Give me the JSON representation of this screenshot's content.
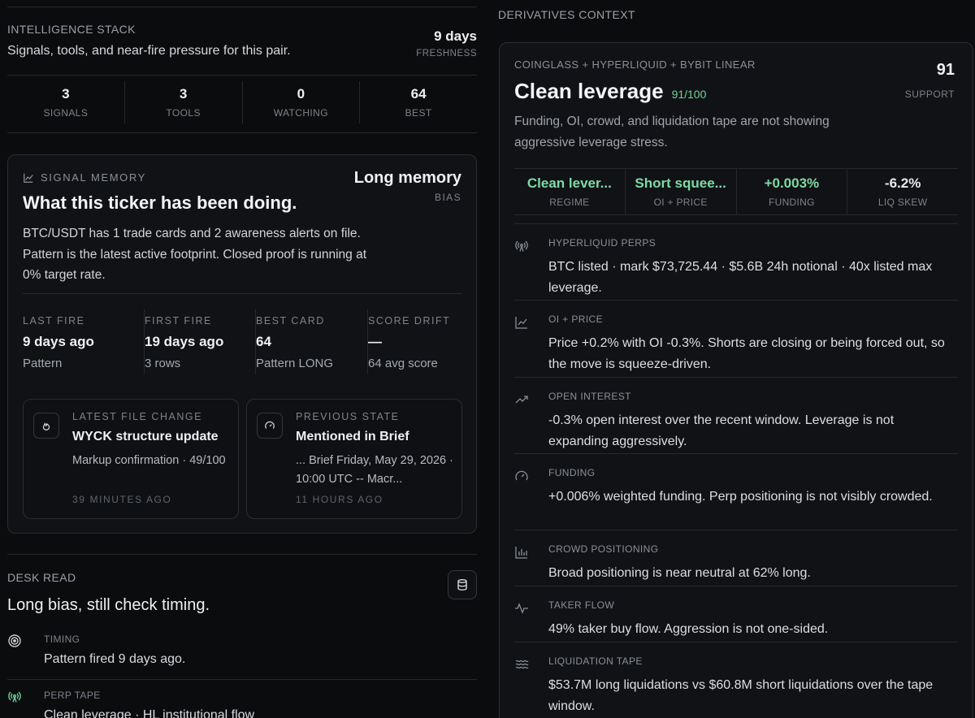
{
  "intel": {
    "title": "INTELLIGENCE STACK",
    "subtitle": "Signals, tools, and near-fire pressure for this pair.",
    "freshness_value": "9 days",
    "freshness_label": "FRESHNESS",
    "stats": [
      {
        "value": "3",
        "label": "SIGNALS"
      },
      {
        "value": "3",
        "label": "TOOLS"
      },
      {
        "value": "0",
        "label": "WATCHING"
      },
      {
        "value": "64",
        "label": "BEST"
      }
    ]
  },
  "memory": {
    "label": "SIGNAL MEMORY",
    "title": "What this ticker has been doing.",
    "bias_value": "Long memory",
    "bias_label": "BIAS",
    "description": "BTC/USDT has 1 trade cards and 2 awareness alerts on file. Pattern is the latest active footprint. Closed proof is running at 0% target rate.",
    "stats": [
      {
        "label": "LAST FIRE",
        "value": "9 days ago",
        "sub": "Pattern"
      },
      {
        "label": "FIRST FIRE",
        "value": "19 days ago",
        "sub": "3 rows"
      },
      {
        "label": "BEST CARD",
        "value": "64",
        "sub": "Pattern LONG"
      },
      {
        "label": "SCORE DRIFT",
        "value": "—",
        "sub": "64 avg score"
      }
    ],
    "cards": [
      {
        "kicker": "LATEST FILE CHANGE",
        "title": "WYCK structure update",
        "desc": "Markup confirmation · 49/100",
        "meta": "39 MINUTES AGO",
        "icon": "flame-icon"
      },
      {
        "kicker": "PREVIOUS STATE",
        "title": "Mentioned in Brief",
        "desc": "... Brief Friday, May 29, 2026 · 10:00 UTC -- Macr...",
        "meta": "11 HOURS AGO",
        "icon": "gauge-icon"
      }
    ]
  },
  "desk": {
    "label": "DESK READ",
    "title": "Long bias, still check timing.",
    "rows": [
      {
        "key": "TIMING",
        "value": "Pattern fired 9 days ago."
      },
      {
        "key": "PERP TAPE",
        "value": "Clean leverage · HL institutional flow"
      }
    ]
  },
  "derivatives": {
    "section_title": "DERIVATIVES CONTEXT",
    "source": "COINGLASS + HYPERLIQUID + BYBIT LINEAR",
    "title": "Clean leverage",
    "score": "91/100",
    "support_value": "91",
    "support_label": "SUPPORT",
    "description": "Funding, OI, crowd, and liquidation tape are not showing aggressive leverage stress.",
    "stats": [
      {
        "value": "Clean lever...",
        "label": "REGIME"
      },
      {
        "value": "Short squee...",
        "label": "OI + PRICE"
      },
      {
        "value": "+0.003%",
        "label": "FUNDING"
      },
      {
        "value": "-6.2%",
        "label": "LIQ SKEW"
      }
    ],
    "rows": [
      {
        "key": "HYPERLIQUID PERPS",
        "value": "BTC listed · mark $73,725.44 · $5.6B 24h notional · 40x listed max leverage.",
        "icon": "broadcast-icon"
      },
      {
        "key": "OI + PRICE",
        "value": "Price +0.2% with OI -0.3%. Shorts are closing or being forced out, so the move is squeeze-driven.",
        "icon": "line-chart-icon"
      },
      {
        "key": "OPEN INTEREST",
        "value": "-0.3% open interest over the recent window. Leverage is not expanding aggressively.",
        "icon": "trending-up-icon"
      },
      {
        "key": "FUNDING",
        "value": "+0.006% weighted funding. Perp positioning is not visibly crowded.",
        "icon": "gauge-icon"
      },
      {
        "key": "CROWD POSITIONING",
        "value": "Broad positioning is near neutral at 62% long.",
        "icon": "bar-chart-icon"
      },
      {
        "key": "TAKER FLOW",
        "value": "49% taker buy flow. Aggression is not one-sided.",
        "icon": "pulse-icon"
      },
      {
        "key": "LIQUIDATION TAPE",
        "value": "$53.7M long liquidations vs $60.8M short liquidations over the tape window.",
        "icon": "waves-icon"
      }
    ]
  },
  "colors": {
    "accent_green": "#6fd39a",
    "background": "#0b0c0e",
    "card": "#111215"
  }
}
